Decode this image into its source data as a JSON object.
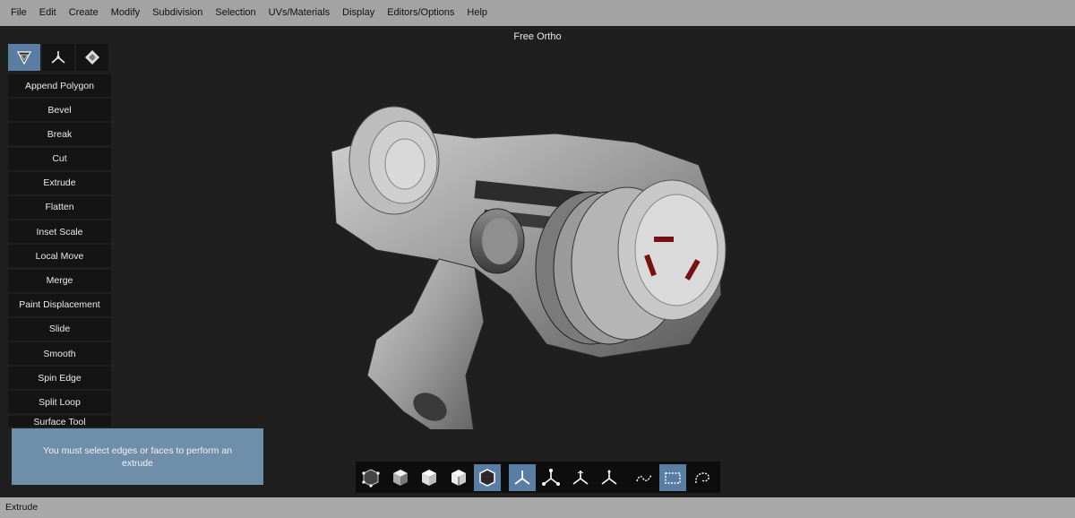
{
  "menubar": {
    "items": [
      "File",
      "Edit",
      "Create",
      "Modify",
      "Subdivision",
      "Selection",
      "UVs/Materials",
      "Display",
      "Editors/Options",
      "Help"
    ]
  },
  "viewport": {
    "title": "Free Ortho"
  },
  "tools": {
    "items": [
      "Append Polygon",
      "Bevel",
      "Break",
      "Cut",
      "Extrude",
      "Flatten",
      "Inset Scale",
      "Local Move",
      "Merge",
      "Paint Displacement",
      "Slide",
      "Smooth",
      "Spin Edge",
      "Split Loop",
      "Surface Tool"
    ]
  },
  "toast": {
    "message": "You must select edges or faces to perform an extrude"
  },
  "status": {
    "text": "Extrude"
  },
  "colors": {
    "accent": "#5a7ea3",
    "panel_bg": "#141414",
    "viewport_bg": "#1f1f1f",
    "toast_bg": "#6e8ea9"
  }
}
